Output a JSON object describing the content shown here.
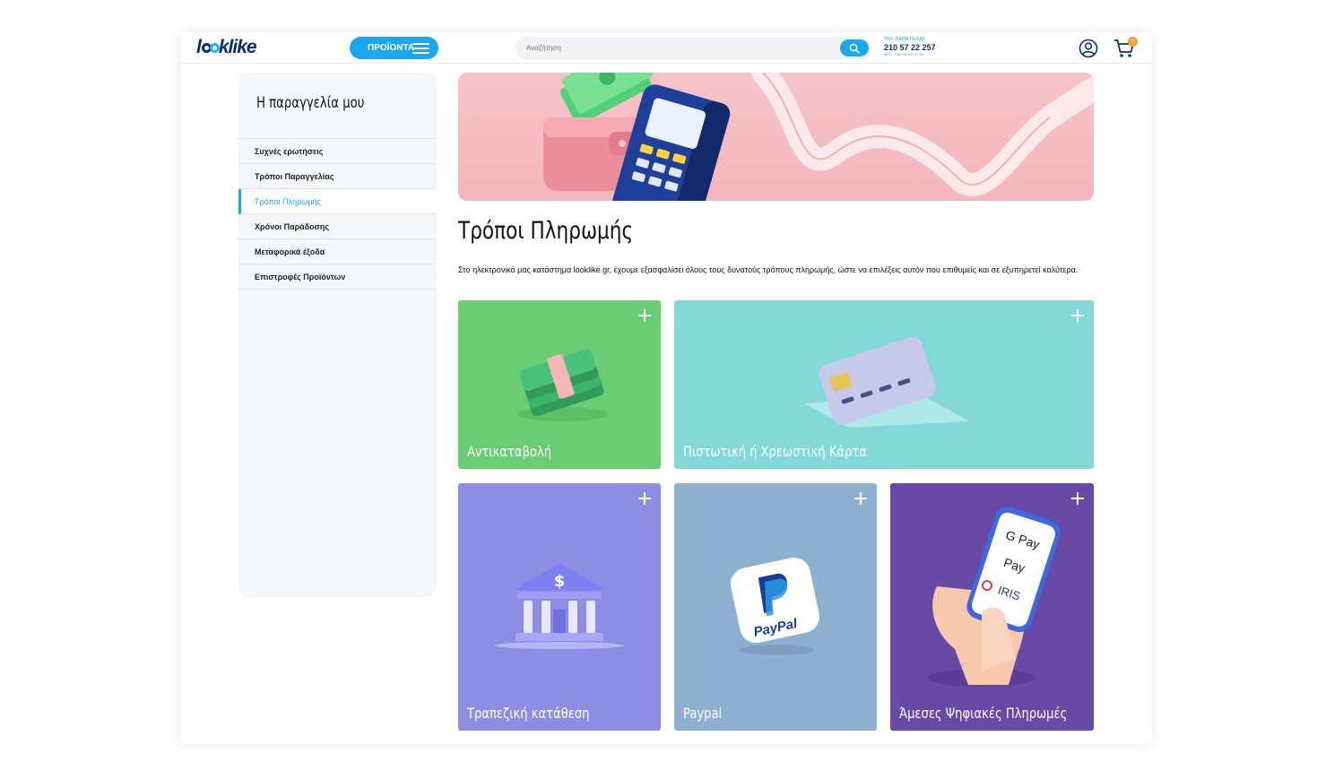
{
  "header": {
    "logo_text": "looklike",
    "products_button": "ΠΡΟΪΟΝΤΑ",
    "search_placeholder": "Αναζήτηση",
    "phone_label": "ΤΗΛ. ΠΑΡΑΓΓΕΛΙΑΣ",
    "phone_number": "210 57 22 257",
    "phone_hours": "ΔΕΥ - ΠΑΡ 09:00 - 17:00",
    "cart_count": "2"
  },
  "sidebar": {
    "title": "Η παραγγελία μου",
    "items": [
      {
        "label": "Συχνές ερωτήσεις"
      },
      {
        "label": "Τρόποι Παραγγελίας"
      },
      {
        "label": "Τρόποι Πληρωμής"
      },
      {
        "label": "Χρόνοι Παράδοσης"
      },
      {
        "label": "Μεταφορικά έξοδα"
      },
      {
        "label": "Επιστροφές Προϊόντων"
      }
    ]
  },
  "main": {
    "title": "Τρόποι Πληρωμής",
    "intro": "Στο ηλεκτρονικό μας κατάστημα looklike.gr, έχουμε εξασφαλίσει όλους τους δυνατούς τρόπους πληρωμής, ώστε να επιλέξεις αυτόν που επιθυμείς και σε εξυπηρετεί καλύτερα.",
    "cards": [
      {
        "label": "Αντικαταβολή",
        "color": "#6bcd73"
      },
      {
        "label": "Πιστωτική ή Χρεωστική Κάρτα",
        "color": "#83d8d8"
      },
      {
        "label": "Τραπεζική κατάθεση",
        "color": "#8d8ee3"
      },
      {
        "label": "Paypal",
        "color": "#8db0d0"
      },
      {
        "label": "Άμεσες Ψηφιακές Πληρωμές",
        "color": "#6849a6"
      }
    ],
    "paypal_logo": "PayPal",
    "wallet_labels": [
      "G Pay",
      " Pay",
      "IRIS"
    ]
  },
  "colors": {
    "accent": "#1aa7ef",
    "brand_dark": "#0a2f6e",
    "badge": "#f7a021"
  }
}
